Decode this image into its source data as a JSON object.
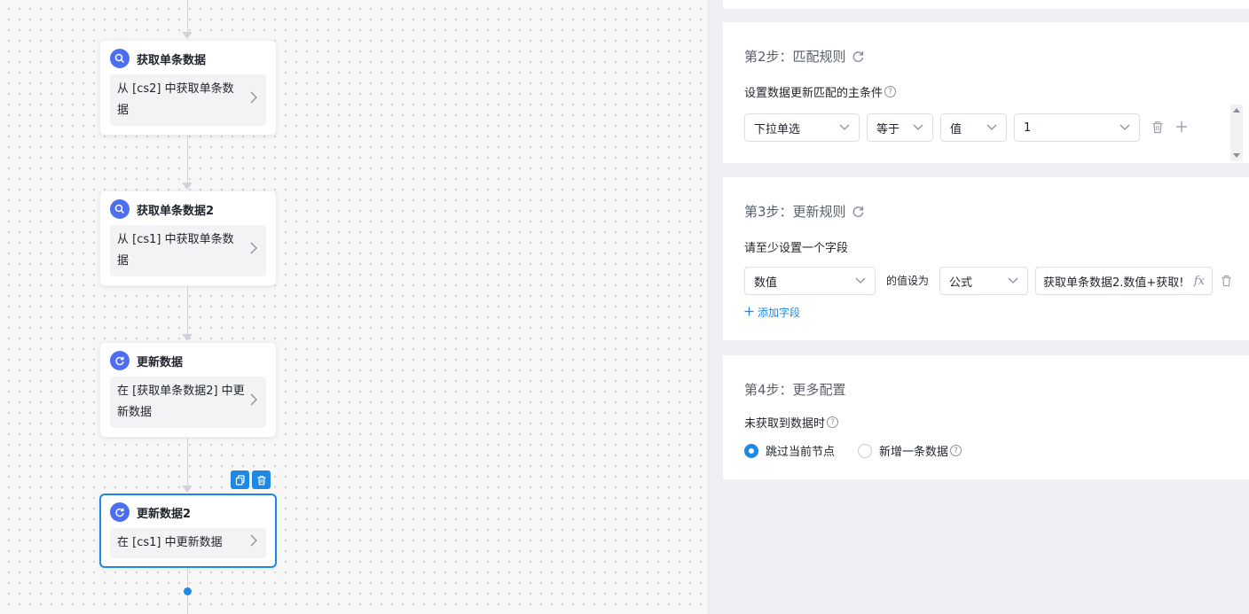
{
  "canvas": {
    "nodes": [
      {
        "title": "获取单条数据",
        "body": "从 [cs2] 中获取单条数据",
        "icon": "search-icon"
      },
      {
        "title": "获取单条数据2",
        "body": "从 [cs1] 中获取单条数据",
        "icon": "search-icon"
      },
      {
        "title": "更新数据",
        "body": "在 [获取单条数据2] 中更新数据",
        "icon": "refresh-icon"
      },
      {
        "title": "更新数据2",
        "body": "在 [cs1] 中更新数据",
        "icon": "refresh-icon"
      }
    ],
    "selected_tools": [
      "copy-icon",
      "delete-icon"
    ]
  },
  "panel": {
    "step2": {
      "title": "第2步：匹配规则",
      "label": "设置数据更新匹配的主条件",
      "field": "下拉单选",
      "operator": "等于",
      "value_type": "值",
      "value": "1"
    },
    "step3": {
      "title": "第3步：更新规则",
      "label": "请至少设置一个字段",
      "field": "数值",
      "set_to": "的值设为",
      "mode": "公式",
      "formula": "获取单条数据2.数值+获取!",
      "fx": "fx",
      "add_field": "添加字段"
    },
    "step4": {
      "title": "第4步：更多配置",
      "label": "未获取到数据时",
      "option_skip": "跳过当前节点",
      "option_add": "新增一条数据",
      "selected": "跳过当前节点"
    }
  },
  "colors": {
    "accent": "#1e88e5",
    "node_icon": "#4e6ef2"
  }
}
